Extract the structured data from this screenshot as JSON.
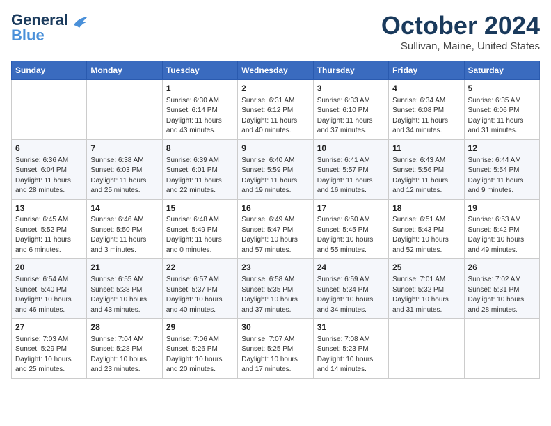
{
  "header": {
    "logo_line1": "General",
    "logo_line2": "Blue",
    "month": "October 2024",
    "location": "Sullivan, Maine, United States"
  },
  "weekdays": [
    "Sunday",
    "Monday",
    "Tuesday",
    "Wednesday",
    "Thursday",
    "Friday",
    "Saturday"
  ],
  "weeks": [
    [
      {
        "day": "",
        "content": ""
      },
      {
        "day": "",
        "content": ""
      },
      {
        "day": "1",
        "content": "Sunrise: 6:30 AM\nSunset: 6:14 PM\nDaylight: 11 hours and 43 minutes."
      },
      {
        "day": "2",
        "content": "Sunrise: 6:31 AM\nSunset: 6:12 PM\nDaylight: 11 hours and 40 minutes."
      },
      {
        "day": "3",
        "content": "Sunrise: 6:33 AM\nSunset: 6:10 PM\nDaylight: 11 hours and 37 minutes."
      },
      {
        "day": "4",
        "content": "Sunrise: 6:34 AM\nSunset: 6:08 PM\nDaylight: 11 hours and 34 minutes."
      },
      {
        "day": "5",
        "content": "Sunrise: 6:35 AM\nSunset: 6:06 PM\nDaylight: 11 hours and 31 minutes."
      }
    ],
    [
      {
        "day": "6",
        "content": "Sunrise: 6:36 AM\nSunset: 6:04 PM\nDaylight: 11 hours and 28 minutes."
      },
      {
        "day": "7",
        "content": "Sunrise: 6:38 AM\nSunset: 6:03 PM\nDaylight: 11 hours and 25 minutes."
      },
      {
        "day": "8",
        "content": "Sunrise: 6:39 AM\nSunset: 6:01 PM\nDaylight: 11 hours and 22 minutes."
      },
      {
        "day": "9",
        "content": "Sunrise: 6:40 AM\nSunset: 5:59 PM\nDaylight: 11 hours and 19 minutes."
      },
      {
        "day": "10",
        "content": "Sunrise: 6:41 AM\nSunset: 5:57 PM\nDaylight: 11 hours and 16 minutes."
      },
      {
        "day": "11",
        "content": "Sunrise: 6:43 AM\nSunset: 5:56 PM\nDaylight: 11 hours and 12 minutes."
      },
      {
        "day": "12",
        "content": "Sunrise: 6:44 AM\nSunset: 5:54 PM\nDaylight: 11 hours and 9 minutes."
      }
    ],
    [
      {
        "day": "13",
        "content": "Sunrise: 6:45 AM\nSunset: 5:52 PM\nDaylight: 11 hours and 6 minutes."
      },
      {
        "day": "14",
        "content": "Sunrise: 6:46 AM\nSunset: 5:50 PM\nDaylight: 11 hours and 3 minutes."
      },
      {
        "day": "15",
        "content": "Sunrise: 6:48 AM\nSunset: 5:49 PM\nDaylight: 11 hours and 0 minutes."
      },
      {
        "day": "16",
        "content": "Sunrise: 6:49 AM\nSunset: 5:47 PM\nDaylight: 10 hours and 57 minutes."
      },
      {
        "day": "17",
        "content": "Sunrise: 6:50 AM\nSunset: 5:45 PM\nDaylight: 10 hours and 55 minutes."
      },
      {
        "day": "18",
        "content": "Sunrise: 6:51 AM\nSunset: 5:43 PM\nDaylight: 10 hours and 52 minutes."
      },
      {
        "day": "19",
        "content": "Sunrise: 6:53 AM\nSunset: 5:42 PM\nDaylight: 10 hours and 49 minutes."
      }
    ],
    [
      {
        "day": "20",
        "content": "Sunrise: 6:54 AM\nSunset: 5:40 PM\nDaylight: 10 hours and 46 minutes."
      },
      {
        "day": "21",
        "content": "Sunrise: 6:55 AM\nSunset: 5:38 PM\nDaylight: 10 hours and 43 minutes."
      },
      {
        "day": "22",
        "content": "Sunrise: 6:57 AM\nSunset: 5:37 PM\nDaylight: 10 hours and 40 minutes."
      },
      {
        "day": "23",
        "content": "Sunrise: 6:58 AM\nSunset: 5:35 PM\nDaylight: 10 hours and 37 minutes."
      },
      {
        "day": "24",
        "content": "Sunrise: 6:59 AM\nSunset: 5:34 PM\nDaylight: 10 hours and 34 minutes."
      },
      {
        "day": "25",
        "content": "Sunrise: 7:01 AM\nSunset: 5:32 PM\nDaylight: 10 hours and 31 minutes."
      },
      {
        "day": "26",
        "content": "Sunrise: 7:02 AM\nSunset: 5:31 PM\nDaylight: 10 hours and 28 minutes."
      }
    ],
    [
      {
        "day": "27",
        "content": "Sunrise: 7:03 AM\nSunset: 5:29 PM\nDaylight: 10 hours and 25 minutes."
      },
      {
        "day": "28",
        "content": "Sunrise: 7:04 AM\nSunset: 5:28 PM\nDaylight: 10 hours and 23 minutes."
      },
      {
        "day": "29",
        "content": "Sunrise: 7:06 AM\nSunset: 5:26 PM\nDaylight: 10 hours and 20 minutes."
      },
      {
        "day": "30",
        "content": "Sunrise: 7:07 AM\nSunset: 5:25 PM\nDaylight: 10 hours and 17 minutes."
      },
      {
        "day": "31",
        "content": "Sunrise: 7:08 AM\nSunset: 5:23 PM\nDaylight: 10 hours and 14 minutes."
      },
      {
        "day": "",
        "content": ""
      },
      {
        "day": "",
        "content": ""
      }
    ]
  ]
}
